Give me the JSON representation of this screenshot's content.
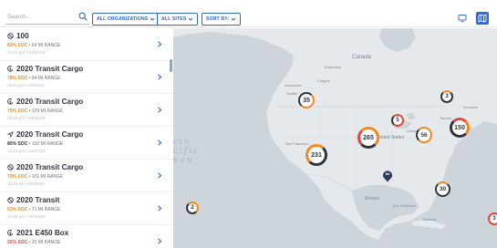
{
  "toolbar": {
    "search_placeholder": "Search...",
    "filters": [
      {
        "label": "ALL ORGANIZATIONS"
      },
      {
        "label": "ALL SITES"
      },
      {
        "label": "SORT BY:"
      }
    ]
  },
  "colors": {
    "accent": "#2f68c9",
    "soc_orange": "#f2891f",
    "soc_red": "#e14a3c",
    "soc_dark": "#2d3440"
  },
  "vehicles": [
    {
      "icon": "not-charging-icon",
      "name": "100",
      "soc": "60% SOC",
      "range": "64 MI RANGE",
      "soc_color": "#f2891f",
      "time": "12:07 pm • 12/07/23"
    },
    {
      "icon": "charging-icon",
      "name": "2020 Transit Cargo",
      "soc": "78% SOC",
      "range": "94 MI RANGE",
      "soc_color": "#f2891f",
      "time": "03:11 pm • 10/30/23"
    },
    {
      "icon": "charging-icon",
      "name": "2020 Transit Cargo",
      "soc": "70% SOC",
      "range": "129 MI RANGE",
      "soc_color": "#f2891f",
      "time": "03:19 pm • 10/30/23"
    },
    {
      "icon": "driving-icon",
      "name": "2020 Transit Cargo",
      "soc": "80% SOC",
      "range": "100 MI RANGE",
      "soc_color": "#2d3440",
      "time": "12:13 pm • 12/07/23"
    },
    {
      "icon": "not-charging-icon",
      "name": "2020 Transit Cargo",
      "soc": "79% SOC",
      "range": "101 MI RANGE",
      "soc_color": "#f2891f",
      "time": "11:15 am • 09/20/23"
    },
    {
      "icon": "not-charging-icon",
      "name": "2020 Transit",
      "soc": "63% SOC",
      "range": "71 MI RANGE",
      "soc_color": "#f2891f",
      "time": "10:39 am • 05/24/23"
    },
    {
      "icon": "charging-icon",
      "name": "2021 E450 Box",
      "soc": "25% SOC",
      "range": "25 MI RANGE",
      "soc_color": "#e14a3c",
      "time": ""
    }
  ],
  "map": {
    "ocean_label": "North Pacific Ocean",
    "ocean_lines": [
      "rth",
      "cific",
      "ean"
    ],
    "labels": [
      {
        "text": "Canada"
      },
      {
        "text": "Edmonton"
      },
      {
        "text": "Calgary"
      },
      {
        "text": "Vancouver"
      },
      {
        "text": "Seattle"
      },
      {
        "text": "Montreal"
      },
      {
        "text": "Toronto"
      },
      {
        "text": "Chicago"
      },
      {
        "text": "United States"
      },
      {
        "text": "San Francisco"
      },
      {
        "text": "Mexico"
      },
      {
        "text": "Gulf of Mexico"
      },
      {
        "text": "Havana"
      }
    ],
    "clusters": [
      {
        "count": "35"
      },
      {
        "count": "3"
      },
      {
        "count": "5"
      },
      {
        "count": "265"
      },
      {
        "count": "56"
      },
      {
        "count": "150"
      },
      {
        "count": "231"
      },
      {
        "count": "30"
      },
      {
        "count": "2"
      },
      {
        "count": "3"
      }
    ],
    "pin_label": "84"
  }
}
